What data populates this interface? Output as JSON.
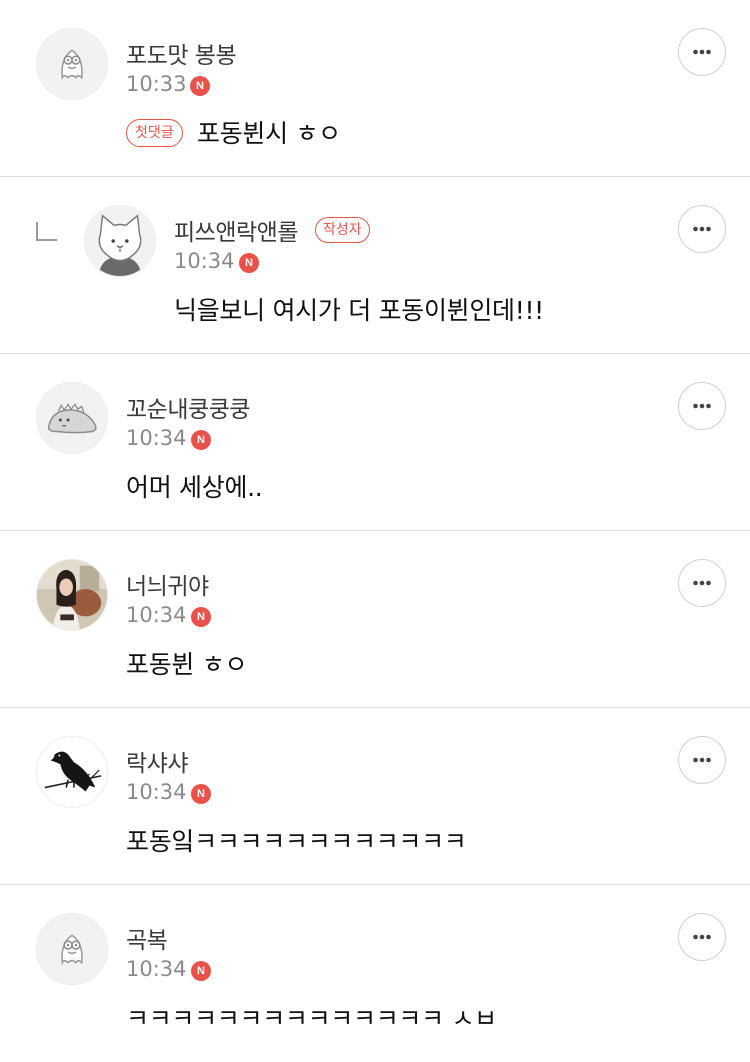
{
  "comments": [
    {
      "nickname": "포도맛 봉봉",
      "time": "10:33",
      "new_badge": "N",
      "first_badge": "첫댓글",
      "text": "포동뷘시 ㅎㅇ",
      "avatar_icon": "default-ghost-avatar-icon"
    },
    {
      "nickname": "피쓰앤락앤롤",
      "author_badge": "작성자",
      "time": "10:34",
      "new_badge": "N",
      "text": "닉을보니 여시가 더 포동이뷘인데!!!",
      "avatar_icon": "cat-avatar-icon",
      "is_reply": true
    },
    {
      "nickname": "꼬순내쿵쿵쿵",
      "time": "10:34",
      "new_badge": "N",
      "text": "어머 세상에..",
      "avatar_icon": "dinosaur-avatar-icon"
    },
    {
      "nickname": "너늬귀야",
      "time": "10:34",
      "new_badge": "N",
      "text": "포동뷘 ㅎㅇ",
      "avatar_icon": "photo-avatar-icon"
    },
    {
      "nickname": "락샤샤",
      "time": "10:34",
      "new_badge": "N",
      "text": "포동잌ㅋㅋㅋㅋㅋㅋㅋㅋㅋㅋㅋㅋ",
      "avatar_icon": "crow-avatar-icon"
    },
    {
      "nickname": "곡복",
      "time": "10:34",
      "new_badge": "N",
      "text": "ㅋㅋㅋㅋㅋㅋㅋㅋㅋㅋㅋㅋㅋㅋ ㅅㅂ",
      "avatar_icon": "default-ghost-avatar-icon"
    }
  ],
  "colors": {
    "accent": "#e4574b",
    "new_badge": "#e8524a",
    "divider": "#dcdcdc",
    "meta_text": "#8a8a8a"
  },
  "icons": {
    "more": "more-horizontal-icon",
    "reply": "reply-arrow-icon"
  }
}
